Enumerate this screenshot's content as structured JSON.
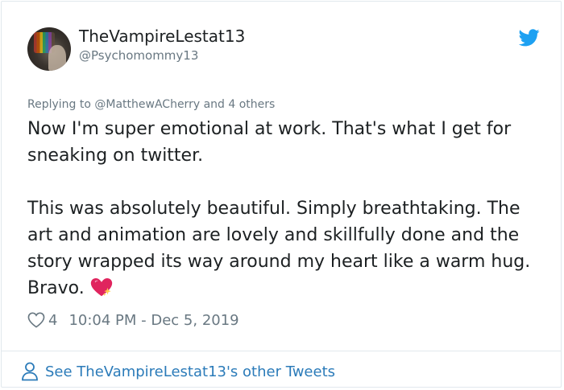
{
  "tweet": {
    "display_name": "TheVampireLestat13",
    "handle": "@Psychomommy13",
    "replying_prefix": "Replying to",
    "replying_mention": "@MatthewACherry",
    "replying_suffix": "and 4 others",
    "text_paragraph_1": "Now I'm super emotional at work. That's what I get for sneaking on twitter.",
    "text_paragraph_2": "This was absolutely beautiful. Simply breathtaking. The art and animation are lovely and skillfully done and the story wrapped its way around my heart like a warm hug. Bravo.",
    "emoji": "sparkling-heart",
    "like_count": "4",
    "timestamp": "10:04 PM - Dec 5, 2019"
  },
  "footer": {
    "label": "See TheVampireLestat13's other Tweets"
  },
  "colors": {
    "twitter_blue": "#1da1f2",
    "link_blue": "#2b7bb9",
    "text_primary": "#1c2022",
    "text_secondary": "#697882",
    "heart_pink": "#e0245e"
  },
  "icons": [
    "avatar",
    "twitter-bird-icon",
    "heart-outline-icon",
    "person-icon",
    "sparkling-heart-emoji"
  ]
}
